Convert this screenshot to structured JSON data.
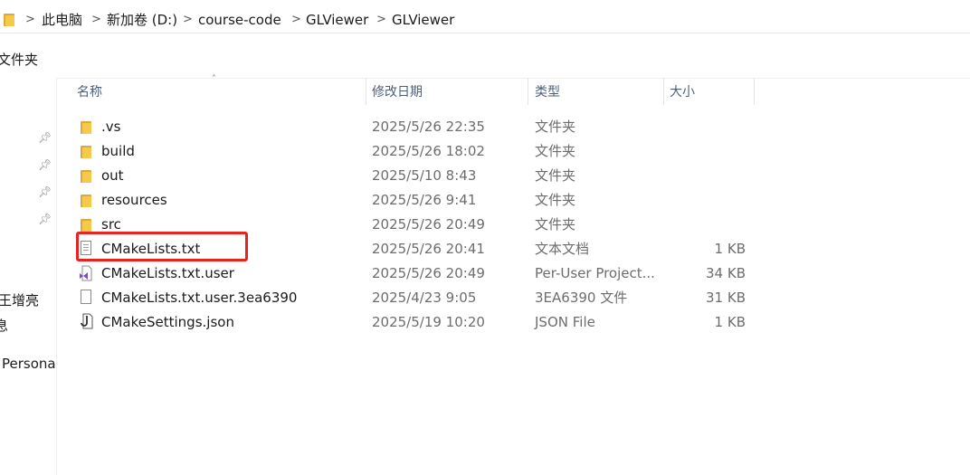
{
  "breadcrumb": [
    "此电脑",
    "新加卷 (D:)",
    "course-code",
    "GLViewer",
    "GLViewer"
  ],
  "toolbar": {
    "label": "文件夹"
  },
  "nav": {
    "items": [
      "王增亮",
      "息",
      "Persona"
    ]
  },
  "columns": {
    "name": "名称",
    "date": "修改日期",
    "type": "类型",
    "size": "大小"
  },
  "files": [
    {
      "name": ".vs",
      "date": "2025/5/26 22:35",
      "type": "文件夹",
      "size": "",
      "icon": "folder-icon"
    },
    {
      "name": "build",
      "date": "2025/5/26 18:02",
      "type": "文件夹",
      "size": "",
      "icon": "folder-icon"
    },
    {
      "name": "out",
      "date": "2025/5/10 8:43",
      "type": "文件夹",
      "size": "",
      "icon": "folder-icon"
    },
    {
      "name": "resources",
      "date": "2025/5/26 9:41",
      "type": "文件夹",
      "size": "",
      "icon": "folder-icon"
    },
    {
      "name": "src",
      "date": "2025/5/26 20:49",
      "type": "文件夹",
      "size": "",
      "icon": "folder-icon"
    },
    {
      "name": "CMakeLists.txt",
      "date": "2025/5/26 20:41",
      "type": "文本文档",
      "size": "1 KB",
      "icon": "text-file-icon"
    },
    {
      "name": "CMakeLists.txt.user",
      "date": "2025/5/26 20:49",
      "type": "Per-User Project...",
      "size": "34 KB",
      "icon": "visual-studio-file-icon"
    },
    {
      "name": "CMakeLists.txt.user.3ea6390",
      "date": "2025/4/23 9:05",
      "type": "3EA6390 文件",
      "size": "31 KB",
      "icon": "blank-file-icon"
    },
    {
      "name": "CMakeSettings.json",
      "date": "2025/5/19 10:20",
      "type": "JSON File",
      "size": "1 KB",
      "icon": "json-file-icon"
    }
  ],
  "colors": {
    "highlight": "#e8231f",
    "folder": "#f5c94c",
    "header_text": "#4c607a"
  }
}
